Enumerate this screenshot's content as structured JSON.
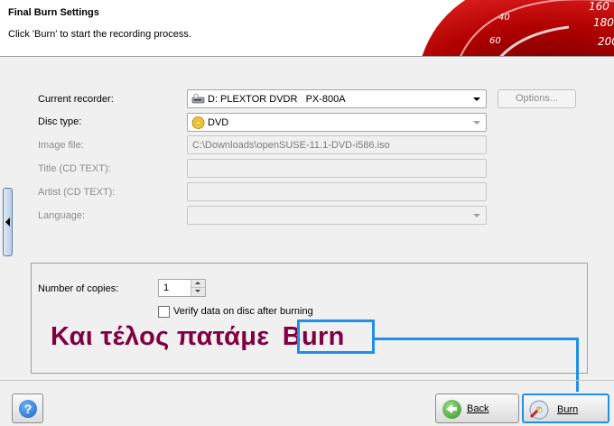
{
  "header": {
    "title": "Final Burn Settings",
    "subtitle": "Click 'Burn' to start the recording process.",
    "gauge_numbers": [
      "160",
      "180",
      "200",
      "40",
      "60"
    ]
  },
  "form": {
    "recorder": {
      "label": "Current recorder:",
      "value": "D: PLEXTOR DVDR   PX-800A",
      "icon": "drive-icon"
    },
    "options_button": "Options...",
    "disc_type": {
      "label": "Disc type:",
      "value": "DVD",
      "icon": "disc-icon"
    },
    "image_file": {
      "label": "Image file:",
      "value": "C:\\Downloads\\openSUSE-11.1-DVD-i586.iso"
    },
    "title": {
      "label": "Title (CD TEXT):",
      "value": ""
    },
    "artist": {
      "label": "Artist (CD TEXT):",
      "value": ""
    },
    "language": {
      "label": "Language:",
      "value": ""
    }
  },
  "options": {
    "copies_label": "Number of copies:",
    "copies_value": "1",
    "verify_label": "Verify data on disc after burning",
    "verify_checked": false
  },
  "annotation": {
    "text": "Και τέλος πατάμε",
    "highlight": "Burn",
    "text_color": "#800040",
    "box_color": "#1e90e8"
  },
  "buttons": {
    "back": "Back",
    "burn": "Burn",
    "help": "?"
  }
}
